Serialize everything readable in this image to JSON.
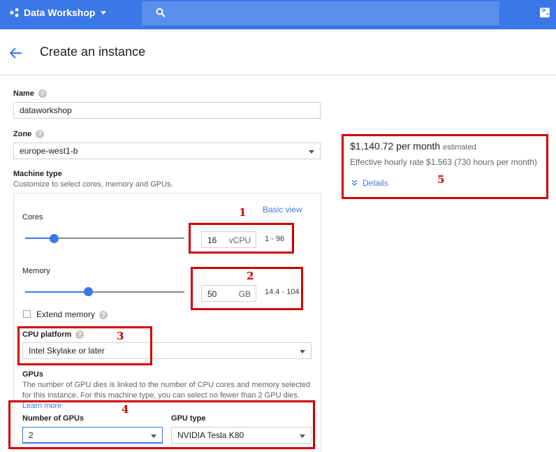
{
  "topbar": {
    "app_name": "Data Workshop",
    "search_placeholder": "",
    "shell_icon": ">_"
  },
  "header": {
    "title": "Create an instance"
  },
  "form": {
    "name": {
      "label": "Name",
      "value": "dataworkshop"
    },
    "zone": {
      "label": "Zone",
      "value": "europe-west1-b"
    },
    "machine_type": {
      "label": "Machine type",
      "description": "Customize to select cores, memory and GPUs.",
      "basic_view": "Basic view",
      "cores": {
        "label": "Cores",
        "value": "16",
        "unit": "vCPU",
        "range": "1 - 96",
        "slider_fraction": 0.18
      },
      "memory": {
        "label": "Memory",
        "value": "50",
        "unit": "GB",
        "range": "14.4 - 104",
        "slider_fraction": 0.4
      },
      "extend_memory": "Extend memory",
      "cpu_platform": {
        "label": "CPU platform",
        "value": "Intel Skylake or later"
      },
      "gpus": {
        "label": "GPUs",
        "description_line1": "The number of GPU dies is linked to the number of CPU cores and memory selected",
        "description_line2": "for this instance. For this machine type, you can select no fewer than 2 GPU dies.",
        "learn_more": "Learn more",
        "number_label": "Number of GPUs",
        "number_value": "2",
        "type_label": "GPU type",
        "type_value": "NVIDIA Tesla K80"
      }
    }
  },
  "cost": {
    "monthly": "$1,140.72 per month",
    "estimated": "estimated",
    "hourly": "Effective hourly rate $1.563 (730 hours per month)",
    "details": "Details"
  },
  "annotations": [
    "1",
    "2",
    "3",
    "4",
    "5"
  ],
  "colors": {
    "brand_blue": "#3b78e7",
    "annotation_red": "#d00000"
  }
}
